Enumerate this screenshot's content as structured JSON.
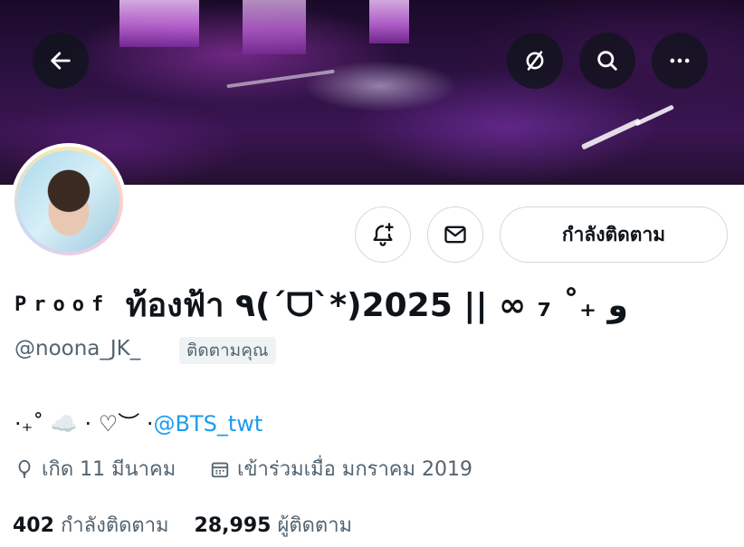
{
  "header": {
    "back_icon": "arrow-left-icon",
    "actions": [
      "hide-reposts-icon",
      "search-icon",
      "more-icon"
    ]
  },
  "profile": {
    "name_prefix": "Proof",
    "name_main": "ท้องฟ้า ٩(ˊᗜˋ*)و ₊˚ ₇ ∞ || 2025",
    "handle": "@noona_JK_",
    "follows_you": "ติดตามคุณ",
    "bio_prefix": "⋅₊˚ ☁️ · ♡︶ ⋅",
    "bio_mention": "@BTS_twt",
    "birthday": "เกิด 11 มีนาคม",
    "joined": "เข้าร่วมเมื่อ มกราคม 2019"
  },
  "buttons": {
    "notify": "bell-plus-icon",
    "message": "mail-icon",
    "following": "กำลังติดตาม"
  },
  "stats": {
    "following_count": "402",
    "following_label": "กำลังติดตาม",
    "followers_count": "28,995",
    "followers_label": "ผู้ติดตาม"
  },
  "colors": {
    "link": "#1d9bf0",
    "secondary_text": "#536471",
    "border": "#cfd9de"
  }
}
